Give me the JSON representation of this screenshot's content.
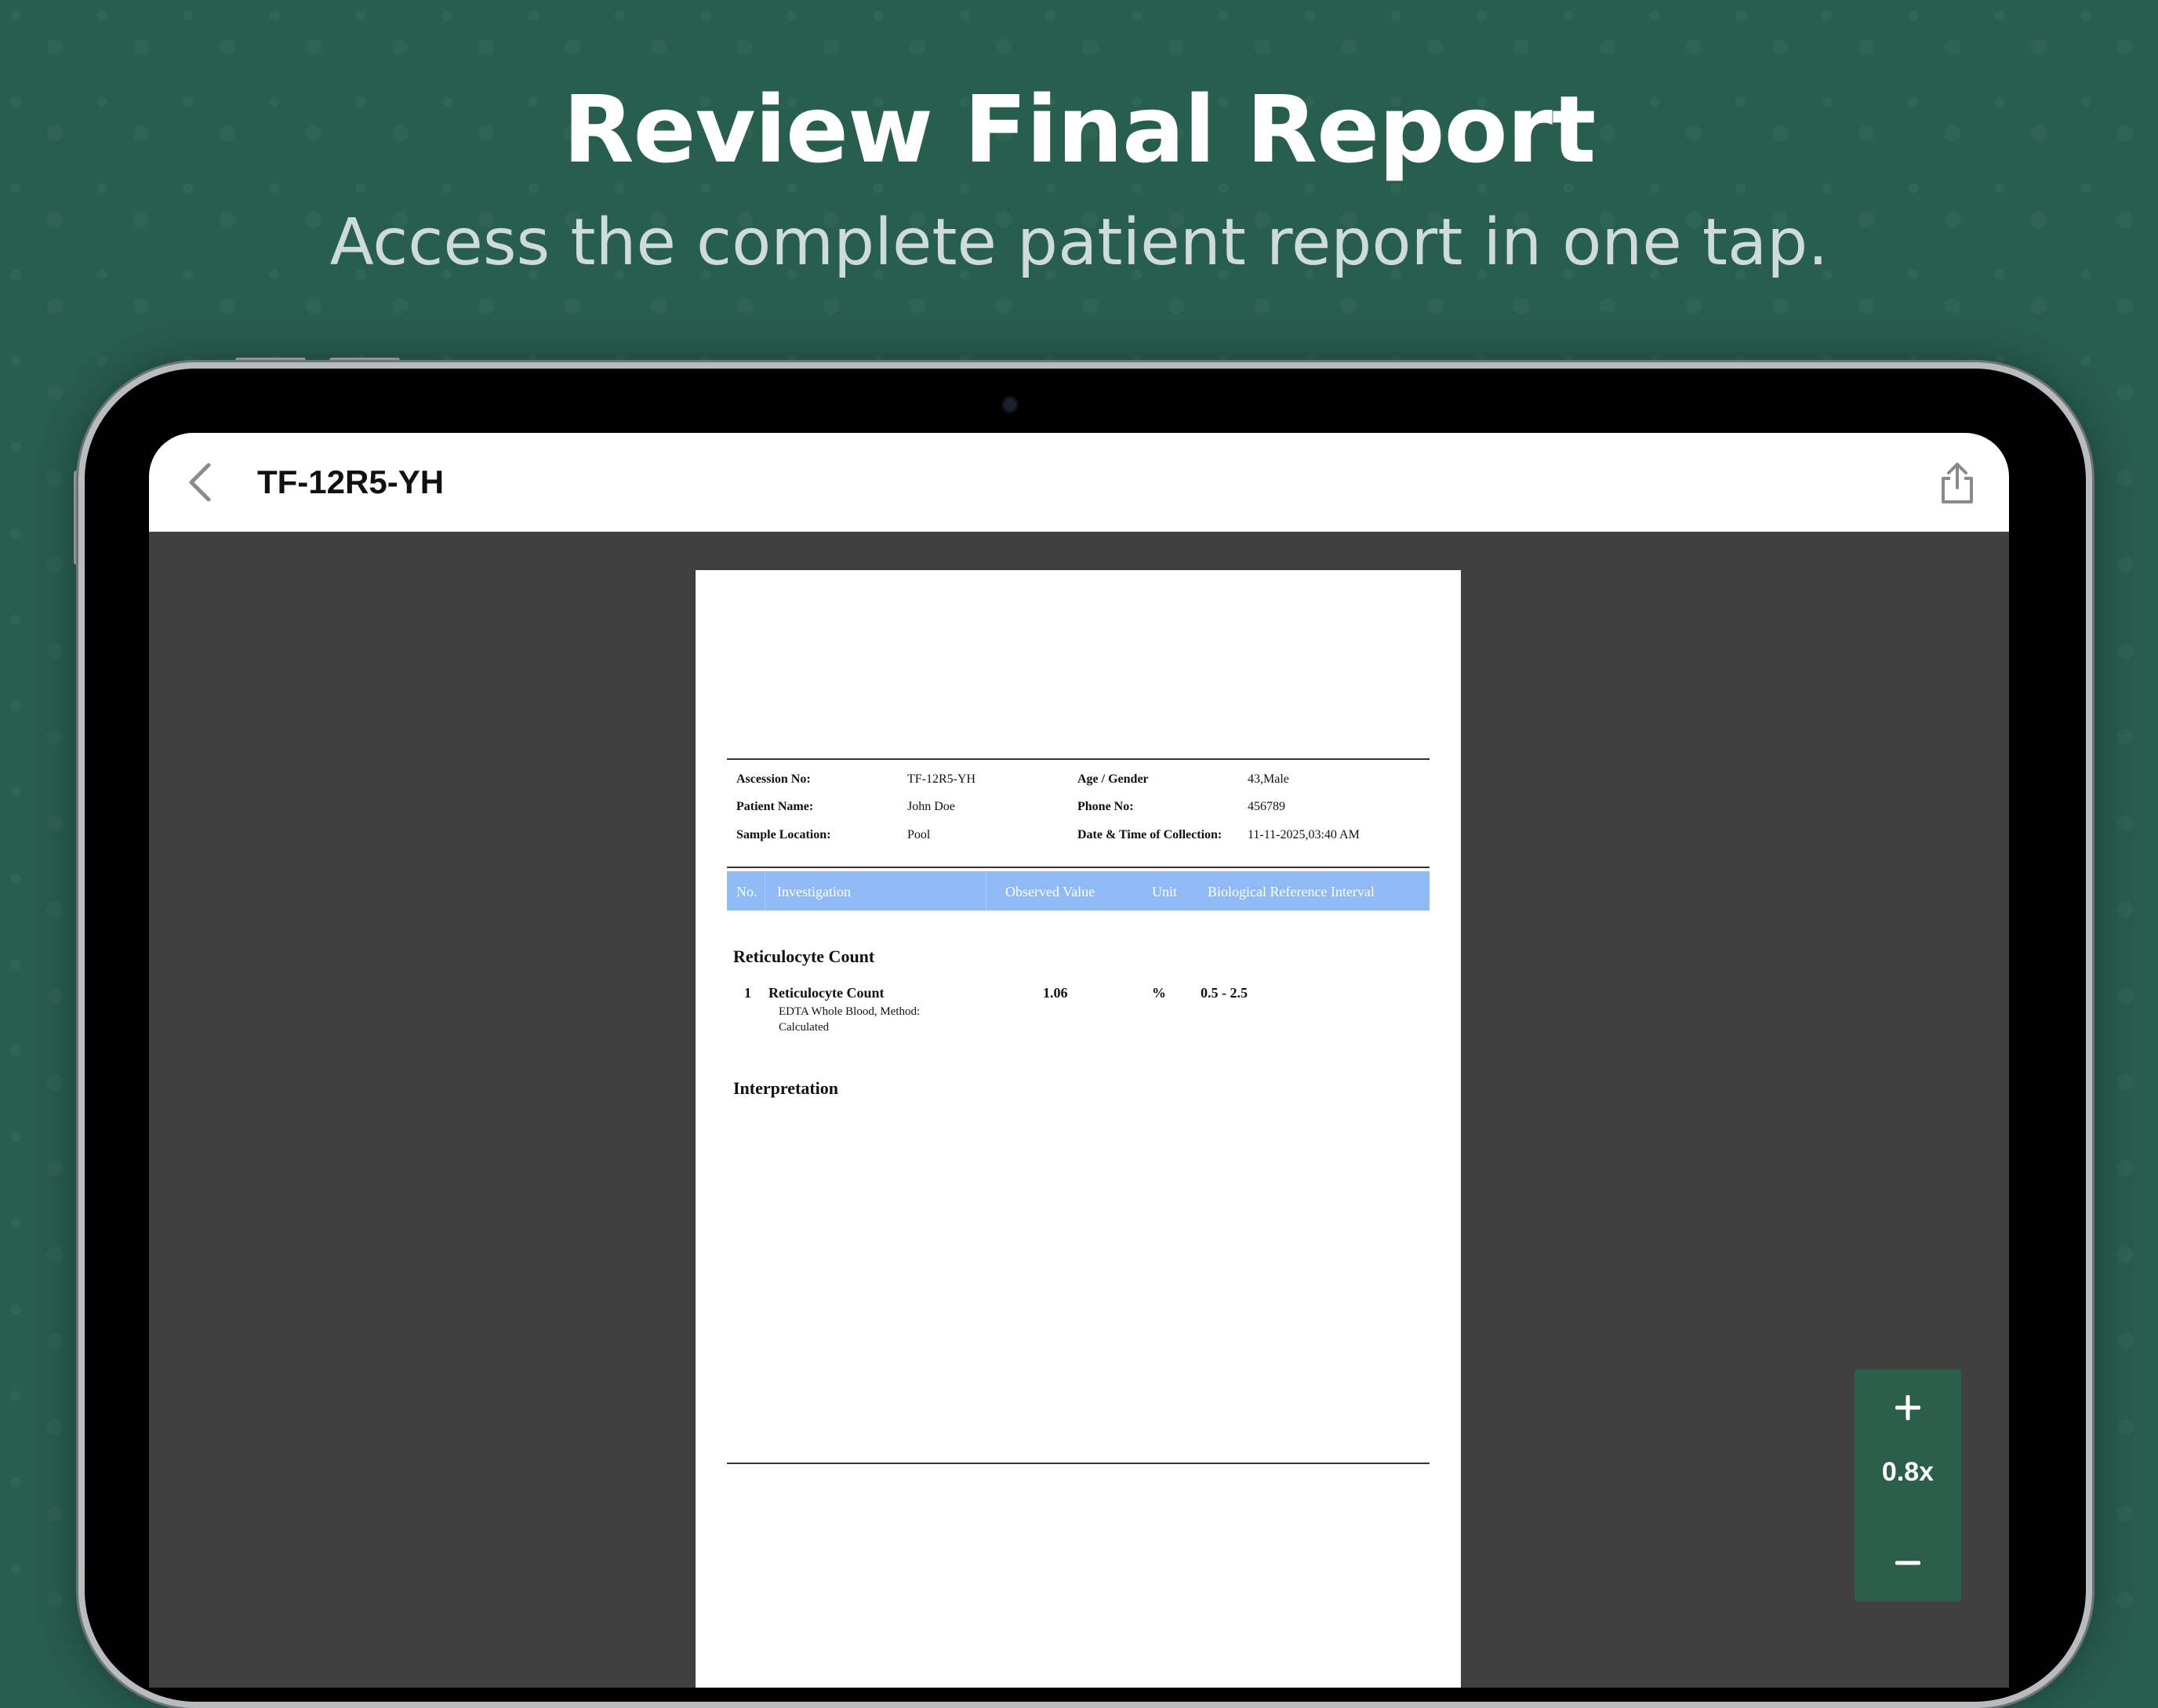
{
  "hero": {
    "title": "Review Final Report",
    "subtitle": "Access the complete patient report in one tap."
  },
  "topbar": {
    "title": "TF-12R5-YH",
    "back_icon": "chevron-left-icon",
    "share_icon": "share-icon"
  },
  "report": {
    "patient_info": [
      {
        "label": "Ascession No:",
        "value": "TF-12R5-YH",
        "label2": "Age / Gender",
        "value2": "43,Male"
      },
      {
        "label": "Patient Name:",
        "value": "John Doe",
        "label2": "Phone No:",
        "value2": "456789"
      },
      {
        "label": "Sample Location:",
        "value": "Pool",
        "label2": "Date & Time of Collection:",
        "value2": "11-11-2025,03:40 AM"
      }
    ],
    "table_headers": [
      "No.",
      "Investigation",
      "Observed Value",
      "Unit",
      "Biological Reference Interval"
    ],
    "section_title": "Reticulocyte Count",
    "rows": [
      {
        "no": "1",
        "name": "Reticulocyte Count",
        "detail_line1": "EDTA Whole Blood, Method:",
        "detail_line2": "Calculated",
        "value": "1.06",
        "unit": "%",
        "range": "0.5 - 2.5"
      }
    ],
    "interpretation_title": "Interpretation"
  },
  "zoom": {
    "plus_label": "+",
    "level": "0.8x",
    "minus_label": "−"
  },
  "colors": {
    "background": "#285e4e",
    "zoom_bg": "#2b5f4c",
    "table_header": "#8fbaf5",
    "viewer_bg": "#404040"
  }
}
